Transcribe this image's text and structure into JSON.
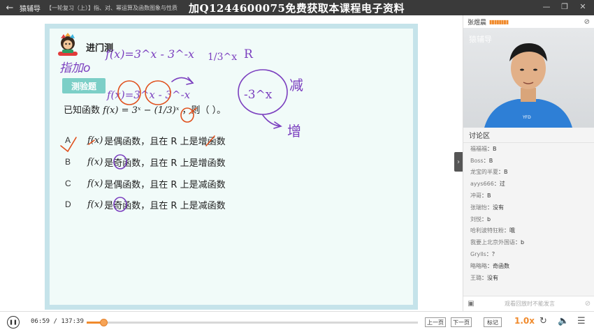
{
  "topbar": {
    "back_icon": "back-arrow-icon",
    "app_name": "猿辅导",
    "course_title": "【一轮复习（上）】指、对、幂运算及函数图象与性质",
    "banner_text": "加Q1244600075免费获取本课程电子资料"
  },
  "slide": {
    "title": "进门测",
    "tag": "测验题",
    "question_prefix": "已知函数",
    "question_math": "f(x) = 3ˣ − (1/3)ˣ",
    "question_suffix": "，则（  ）。",
    "options": [
      {
        "letter": "A",
        "fx": "f(x)",
        "text": "是偶函数，且在 R 上是增函数"
      },
      {
        "letter": "B",
        "fx": "f(x)",
        "text": "是奇函数，且在 R 上是增函数"
      },
      {
        "letter": "C",
        "fx": "f(x)",
        "text": "是偶函数，且在 R 上是减函数"
      },
      {
        "letter": "D",
        "fx": "f(x)",
        "text": "是奇函数，且在 R 上是减函数"
      }
    ],
    "handwriting": {
      "note_left": "指加o",
      "line1": "f(x)=3^x - 3^-x",
      "line2": "f(x)=3^x - 3^-x",
      "fraction": "1/3^x",
      "r_label": "R",
      "circled": "-3^x",
      "decrease": "减",
      "increase": "增"
    }
  },
  "sidebar": {
    "teacher_name": "张煜晨",
    "watermark": "猿辅导",
    "chat_title": "讨论区",
    "messages": [
      {
        "name": "福福福",
        "text": "：B"
      },
      {
        "name": "Boss",
        "text": "：B"
      },
      {
        "name": "龙宝的半夏",
        "text": "：B"
      },
      {
        "name": "ayys666",
        "text": "：过"
      },
      {
        "name": "冲哥",
        "text": "：B"
      },
      {
        "name": "张瑞怡",
        "text": "：没有"
      },
      {
        "name": "刘悦",
        "text": "：b"
      },
      {
        "name": "哈利波特狂粉",
        "text": "：哦"
      },
      {
        "name": "我要上北京外国语",
        "text": "：b"
      },
      {
        "name": "Grylls",
        "text": "：？"
      },
      {
        "name": "略略略",
        "text": "：奇函数"
      },
      {
        "name": "王璐",
        "text": "：没有"
      },
      {
        "name": "Nidx",
        "text": "：B"
      }
    ],
    "input_placeholder": "观看回放时不能发言"
  },
  "controls": {
    "time": "06:59 / 137:39",
    "progress": 0.051,
    "prev_page": "上一页",
    "next_page": "下一页",
    "mark": "标记",
    "speed": "1.0x"
  },
  "colors": {
    "accent": "#f08a2c",
    "ink": "#7b3fbf",
    "tag": "#7ccfc7",
    "frame": "#c5e3ea"
  }
}
